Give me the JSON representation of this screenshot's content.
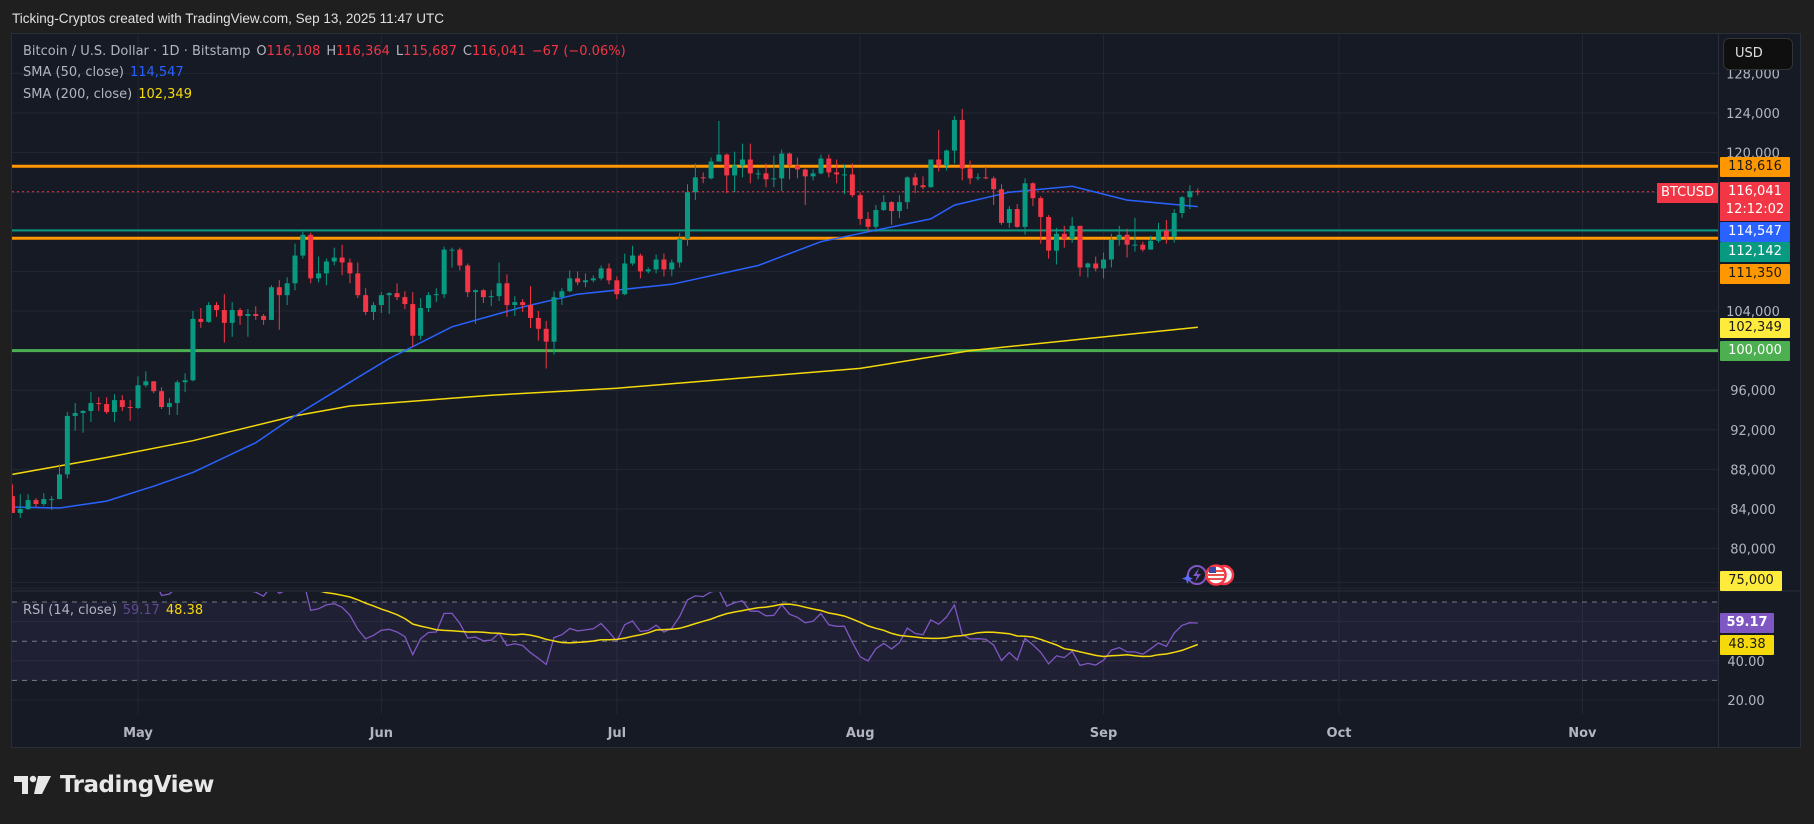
{
  "attribution": "Ticking-Cryptos created with TradingView.com, Sep 13, 2025 11:47 UTC",
  "legend": {
    "symbol": "Bitcoin / U.S. Dollar · 1D · Bitstamp",
    "open_label": "O",
    "open": "116,108",
    "high_label": "H",
    "high": "116,364",
    "low_label": "L",
    "low": "115,687",
    "close_label": "C",
    "close": "116,041",
    "change": "−67 (−0.06%)",
    "sma50_label": "SMA (50, close)",
    "sma50_value": "114,547",
    "sma200_label": "SMA (200, close)",
    "sma200_value": "102,349",
    "rsi_label": "RSI (14, close)",
    "rsi_value": "59.17",
    "rsi_ma_value": "48.38"
  },
  "currency_button": "USD",
  "price_badges": {
    "resistance_top": "118,616",
    "symbol": "BTCUSD",
    "last_price": "116,041",
    "countdown": "12:12:02",
    "sma50": "114,547",
    "support_teal": "112,142",
    "support_orange": "111,350",
    "sma200": "102,349",
    "round_level": "100,000",
    "low_marker": "75,000",
    "rsi": "59.17",
    "rsi_ma": "48.38"
  },
  "colors": {
    "up": "#089981",
    "down": "#f23645",
    "sma50": "#2962ff",
    "sma200": "#f5d90a",
    "rsi": "#7e57c2",
    "rsi_ma": "#f5d90a",
    "orange_level": "#ff9800",
    "teal_level": "#089981",
    "green_level": "#4caf50"
  },
  "icons": [
    "lightning-event-icon",
    "us-flag-economic-event-icon"
  ],
  "branding": "TradingView",
  "chart_data": {
    "type": "candlestick",
    "interval": "1D",
    "x_start": "2025-04-15",
    "first_open": 85300,
    "close": [
      83600,
      84000,
      84900,
      84500,
      85000,
      85000,
      87500,
      93400,
      93700,
      93900,
      94700,
      94600,
      93800,
      95000,
      94300,
      94200,
      96500,
      96900,
      95900,
      94300,
      94700,
      96800,
      97000,
      103200,
      102900,
      104600,
      104100,
      102800,
      104100,
      103500,
      103700,
      103500,
      103100,
      106400,
      105600,
      106800,
      109600,
      111700,
      107300,
      107800,
      109000,
      109400,
      108900,
      107800,
      105600,
      103900,
      104600,
      105600,
      105800,
      105400,
      104700,
      101500,
      104300,
      105600,
      105700,
      110200,
      110200,
      108600,
      105900,
      106100,
      105400,
      105500,
      106800,
      104600,
      104900,
      104600,
      103300,
      102200,
      100900,
      105400,
      106000,
      107300,
      106900,
      107100,
      107300,
      108300,
      107100,
      105700,
      108800,
      109600,
      108000,
      108200,
      109200,
      108200,
      108900,
      111300,
      116000,
      117500,
      117400,
      119100,
      119800,
      117700,
      118700,
      119300,
      117900,
      117900,
      117300,
      117400,
      119900,
      118700,
      118300,
      117600,
      117900,
      119400,
      118000,
      117800,
      117800,
      115700,
      113300,
      112500,
      114200,
      115000,
      114100,
      115000,
      117500,
      116700,
      116500,
      119300,
      118700,
      120200,
      123300,
      118400,
      117400,
      117500,
      117400,
      116300,
      112900,
      114300,
      112500,
      116900,
      115400,
      113500,
      110100,
      111800,
      111300,
      112600,
      108400,
      108800,
      108300,
      109200,
      111200,
      111700,
      110700,
      110700,
      110200,
      111100,
      112100,
      111500,
      113900,
      115500,
      116100,
      116041
    ],
    "high": [
      86500,
      85500,
      85500,
      85100,
      85600,
      85300,
      88500,
      93800,
      94700,
      94000,
      95800,
      95300,
      95300,
      95600,
      95500,
      95000,
      97400,
      97900,
      96900,
      96300,
      95200,
      97000,
      97700,
      104000,
      104300,
      104900,
      104900,
      105700,
      104900,
      104300,
      104200,
      104500,
      103700,
      106600,
      107100,
      107400,
      110800,
      112000,
      111900,
      109500,
      109300,
      110400,
      110700,
      109300,
      108900,
      106300,
      104900,
      105900,
      105900,
      106800,
      106000,
      105900,
      105300,
      105900,
      106300,
      110500,
      110400,
      110400,
      108800,
      106200,
      106200,
      106100,
      108900,
      107700,
      105500,
      105200,
      106500,
      104000,
      103000,
      106000,
      106300,
      108100,
      108000,
      107800,
      107600,
      108600,
      108800,
      107500,
      109800,
      110600,
      109800,
      108400,
      109700,
      109800,
      109200,
      111900,
      116800,
      118900,
      118000,
      119500,
      123200,
      119900,
      120100,
      120900,
      120900,
      118300,
      118900,
      119700,
      120300,
      120000,
      119500,
      118400,
      118300,
      119800,
      119800,
      119300,
      118800,
      118900,
      116000,
      114000,
      114700,
      115700,
      115100,
      115700,
      117600,
      117900,
      117600,
      119300,
      122300,
      120300,
      123700,
      124400,
      119200,
      117900,
      118600,
      117600,
      116800,
      114600,
      114800,
      117400,
      117000,
      115600,
      113700,
      112400,
      112600,
      113500,
      112600,
      108900,
      109500,
      109900,
      111800,
      112600,
      112300,
      113400,
      111000,
      111600,
      112900,
      113200,
      114300,
      115600,
      116700,
      116364
    ],
    "low": [
      83600,
      83100,
      83900,
      84200,
      84300,
      83900,
      85000,
      87100,
      91900,
      91700,
      92800,
      93900,
      93600,
      92800,
      93900,
      92900,
      94100,
      96300,
      95700,
      94100,
      93500,
      93500,
      95800,
      96900,
      102300,
      102800,
      103400,
      100800,
      101400,
      102600,
      101400,
      103100,
      102600,
      103100,
      102100,
      104600,
      106100,
      109300,
      106800,
      106900,
      106600,
      108600,
      107600,
      106800,
      105300,
      103600,
      103100,
      103800,
      103700,
      105100,
      104200,
      100400,
      101100,
      103900,
      104900,
      105300,
      108400,
      108100,
      105400,
      102700,
      104800,
      104500,
      105000,
      103400,
      103500,
      103900,
      102300,
      101000,
      98200,
      99600,
      104600,
      105900,
      106600,
      106400,
      106900,
      107100,
      106700,
      105200,
      105600,
      108600,
      107300,
      107800,
      107800,
      107500,
      107500,
      108400,
      110600,
      115200,
      116900,
      117300,
      119100,
      115900,
      116000,
      117500,
      116900,
      117300,
      116500,
      116500,
      116100,
      117300,
      117400,
      114700,
      117200,
      117800,
      117500,
      116900,
      115800,
      115500,
      112700,
      112000,
      112000,
      114100,
      112700,
      113400,
      114300,
      115900,
      116300,
      116500,
      118100,
      118200,
      118900,
      117200,
      116800,
      117200,
      117300,
      114700,
      112700,
      112400,
      112400,
      111700,
      114600,
      110800,
      109300,
      108700,
      110400,
      110900,
      107500,
      107400,
      108000,
      107300,
      108400,
      110600,
      109400,
      110000,
      110000,
      110200,
      110900,
      110800,
      110900,
      113400,
      114300,
      115687
    ],
    "sma50_points": [
      [
        "2025-04-15",
        84200
      ],
      [
        "2025-04-21",
        84100
      ],
      [
        "2025-04-27",
        84800
      ],
      [
        "2025-05-03",
        86300
      ],
      [
        "2025-05-08",
        87700
      ],
      [
        "2025-05-16",
        90700
      ],
      [
        "2025-05-21",
        93400
      ],
      [
        "2025-05-28",
        96800
      ],
      [
        "2025-06-02",
        99200
      ],
      [
        "2025-06-10",
        102400
      ],
      [
        "2025-06-19",
        104400
      ],
      [
        "2025-06-26",
        105700
      ],
      [
        "2025-07-08",
        106700
      ],
      [
        "2025-07-19",
        108600
      ],
      [
        "2025-07-27",
        111000
      ],
      [
        "2025-08-02",
        112000
      ],
      [
        "2025-08-10",
        113300
      ],
      [
        "2025-08-13",
        114700
      ],
      [
        "2025-08-20",
        116000
      ],
      [
        "2025-08-28",
        116600
      ],
      [
        "2025-09-04",
        115200
      ],
      [
        "2025-09-13",
        114547
      ]
    ],
    "sma200_points": [
      [
        "2025-04-15",
        87500
      ],
      [
        "2025-04-27",
        89200
      ],
      [
        "2025-05-08",
        90900
      ],
      [
        "2025-05-21",
        93400
      ],
      [
        "2025-05-28",
        94400
      ],
      [
        "2025-06-15",
        95500
      ],
      [
        "2025-07-01",
        96200
      ],
      [
        "2025-08-01",
        98200
      ],
      [
        "2025-08-15",
        100000
      ],
      [
        "2025-09-13",
        102349
      ]
    ],
    "horizontal_levels": [
      {
        "value": 118616,
        "color": "#ff9800",
        "style": "solid"
      },
      {
        "value": 112142,
        "color": "#089981",
        "style": "solid"
      },
      {
        "value": 111350,
        "color": "#ff9800",
        "style": "solid"
      },
      {
        "value": 100000,
        "color": "#4caf50",
        "style": "solid"
      },
      {
        "value": 116041,
        "color": "#f23645",
        "style": "dotted"
      }
    ],
    "y_ticks": [
      {
        "value": 128000,
        "label": "128,000"
      },
      {
        "value": 124000,
        "label": "124,000"
      },
      {
        "value": 120000,
        "label": "120,000"
      },
      {
        "value": 104000,
        "label": "104,000"
      },
      {
        "value": 96000,
        "label": "96,000"
      },
      {
        "value": 92000,
        "label": "92,000"
      },
      {
        "value": 88000,
        "label": "88,000"
      },
      {
        "value": 84000,
        "label": "84,000"
      },
      {
        "value": 80000,
        "label": "80,000"
      }
    ],
    "grid_y_values": [
      128000,
      124000,
      120000,
      116000,
      112000,
      108000,
      104000,
      100000,
      96000,
      92000,
      88000,
      84000,
      80000,
      76000
    ],
    "x_ticks": [
      {
        "date": "2025-05-01",
        "label": "May"
      },
      {
        "date": "2025-06-01",
        "label": "Jun"
      },
      {
        "date": "2025-07-01",
        "label": "Jul"
      },
      {
        "date": "2025-08-01",
        "label": "Aug"
      },
      {
        "date": "2025-09-01",
        "label": "Sep"
      },
      {
        "date": "2025-10-01",
        "label": "Oct"
      },
      {
        "date": "2025-11-01",
        "label": "Nov"
      }
    ],
    "grid": true,
    "rsi": {
      "period": 14,
      "ma_period": 14,
      "upper_band": 70,
      "middle_band": 50,
      "lower_band": 30,
      "ticks": [
        {
          "value": 40,
          "label": "40.00"
        },
        {
          "value": 20,
          "label": "20.00"
        }
      ],
      "grid_values": [
        80,
        60,
        40,
        20
      ]
    }
  }
}
